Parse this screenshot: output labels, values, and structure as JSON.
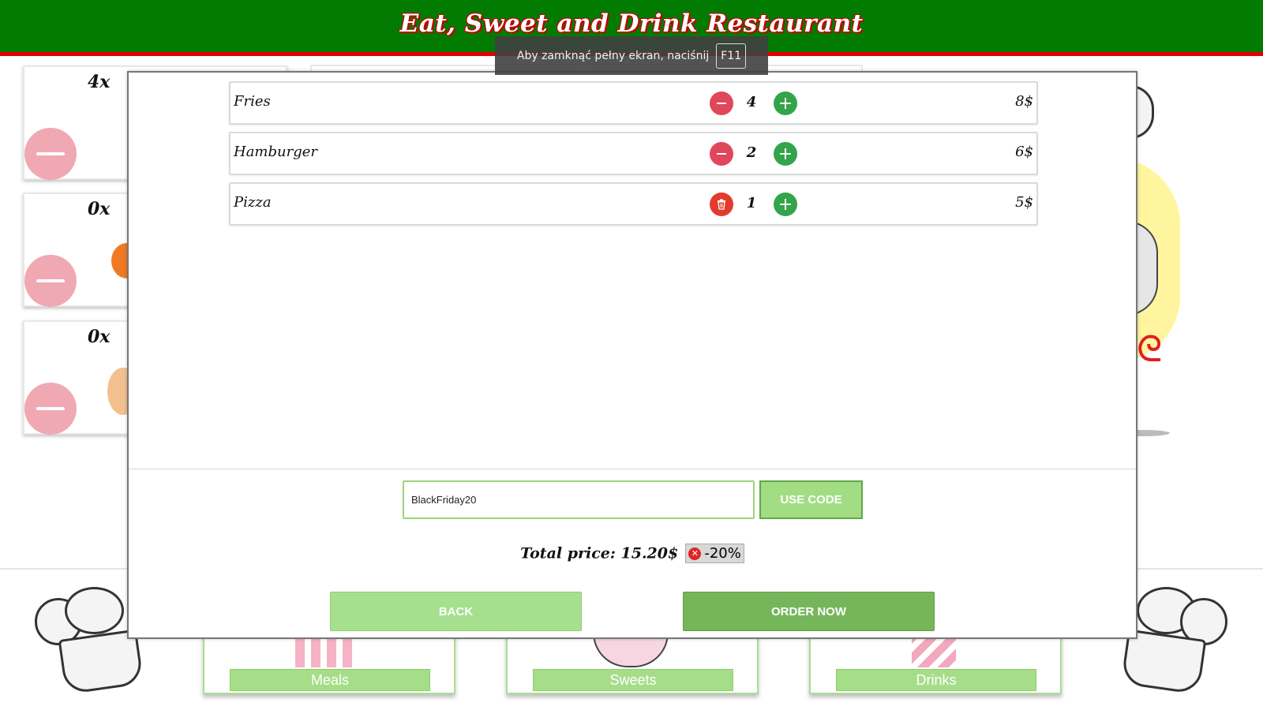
{
  "header": {
    "title": "Eat, Sweet and Drink Restaurant"
  },
  "toast": {
    "text": "Aby zamknąć pełny ekran, naciśnij",
    "key": "F11"
  },
  "background_cards": [
    {
      "qty": "4x"
    },
    {
      "qty": "0x"
    },
    {
      "qty": "0x"
    }
  ],
  "categories": [
    {
      "label": "Meals"
    },
    {
      "label": "Sweets"
    },
    {
      "label": "Drinks"
    }
  ],
  "order": {
    "items": [
      {
        "name": "Fries",
        "qty": "4",
        "price": "8$",
        "decrement": "minus-icon"
      },
      {
        "name": "Hamburger",
        "qty": "2",
        "price": "6$",
        "decrement": "minus-icon"
      },
      {
        "name": "Pizza",
        "qty": "1",
        "price": "5$",
        "decrement": "trash-icon"
      }
    ],
    "code_value": "BlackFriday20",
    "use_code_label": "USE CODE",
    "total_text": "Total price: 15.20$",
    "discount": "-20%",
    "back_label": "BACK",
    "order_label": "ORDER NOW"
  },
  "colors": {
    "header_bg": "#017b02",
    "header_border": "#e10000",
    "minus_red": "#e0475a",
    "plus_green": "#33a44a",
    "button_light_green": "#a6e08f",
    "button_dark_green": "#76b65b"
  }
}
